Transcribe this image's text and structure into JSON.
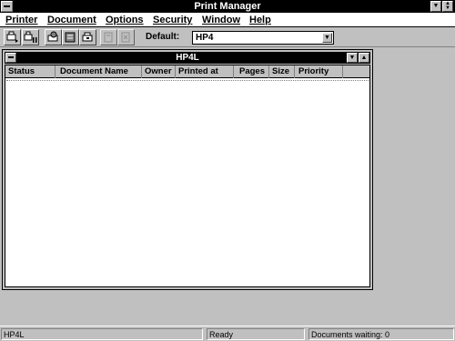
{
  "app": {
    "title": "Print Manager"
  },
  "menu": [
    {
      "label": "Printer"
    },
    {
      "label": "Document"
    },
    {
      "label": "Options"
    },
    {
      "label": "Security"
    },
    {
      "label": "Window"
    },
    {
      "label": "Help"
    }
  ],
  "toolbar": {
    "default_label": "Default:",
    "default_printer": "HP4",
    "buttons": [
      {
        "name": "connect-printer-icon",
        "enabled": true
      },
      {
        "name": "pause-printer-icon",
        "enabled": true
      },
      {
        "name": "printer-properties-icon",
        "enabled": true
      },
      {
        "name": "document-details-icon",
        "enabled": true
      },
      {
        "name": "printer-setup-icon",
        "enabled": true
      },
      {
        "name": "pause-document-icon",
        "enabled": false
      },
      {
        "name": "delete-document-icon",
        "enabled": false
      }
    ]
  },
  "window": {
    "title": "HP4L",
    "columns": [
      "Status",
      "Document Name",
      "Owner",
      "Printed at",
      "Pages",
      "Size",
      "Priority"
    ],
    "rows": []
  },
  "status": {
    "printer": "HP4L",
    "state": "Ready",
    "waiting": "Documents waiting: 0"
  }
}
